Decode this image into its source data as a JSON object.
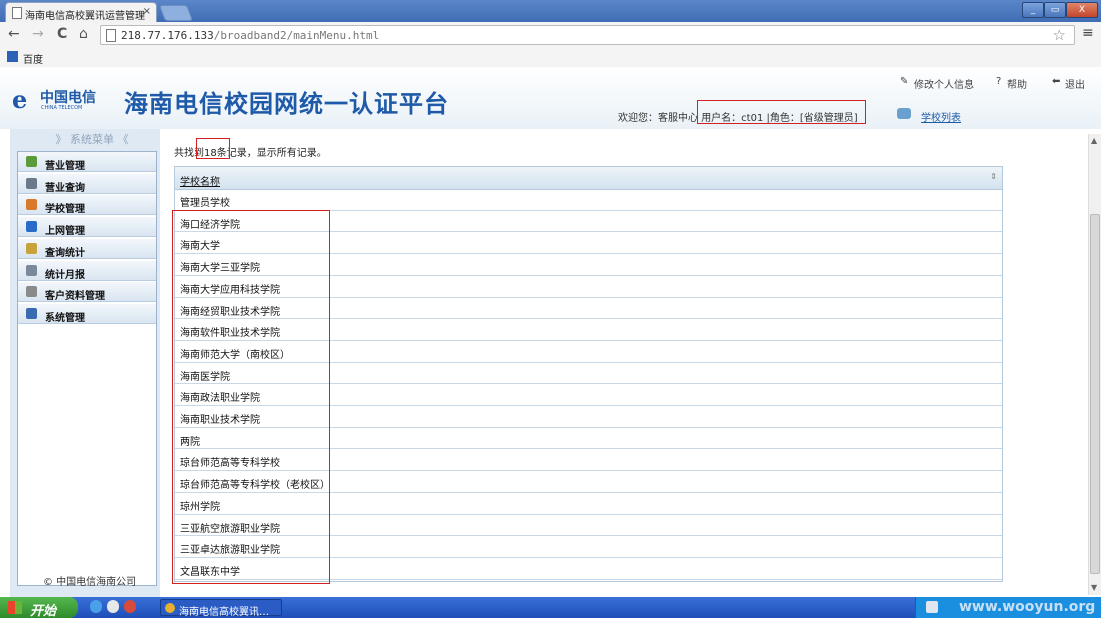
{
  "browser": {
    "tab_title": "海南电信高校翼讯运营管理",
    "tab_close": "×",
    "url_host": "218.77.176.133",
    "url_path": "/broadband2/mainMenu.html",
    "back_glyph": "←",
    "forward_glyph": "→",
    "reload_glyph": "C",
    "home_glyph": "⌂",
    "star_glyph": "☆",
    "menu_glyph": "≡",
    "minimize": "_",
    "restore": "▭",
    "close": "X",
    "bookmark_label": "百度"
  },
  "header": {
    "logo_cn": "中国电信",
    "logo_en": "CHINA TELECOM",
    "logo_e": "e",
    "title": "海南电信校园网统一认证平台",
    "links": {
      "profile": "修改个人信息",
      "help": "帮助",
      "logout": "退出"
    },
    "link_icons": {
      "profile": "wrench-icon",
      "help": "question-icon",
      "logout": "back-arrow-icon"
    },
    "welcome": "欢迎您：客服中心",
    "username": "用户名：ct01",
    "role": "|角色：[省级管理员]",
    "school_list": "学校列表"
  },
  "sidebar": {
    "heading": "》 系统菜单 《",
    "items": [
      {
        "label": "营业管理",
        "icon": "users-icon",
        "color": "#5a9a3a"
      },
      {
        "label": "营业查询",
        "icon": "key-icon",
        "color": "#6a7a8a"
      },
      {
        "label": "学校管理",
        "icon": "school-icon",
        "color": "#d87a2a"
      },
      {
        "label": "上网管理",
        "icon": "monitor-icon",
        "color": "#2a6ac8"
      },
      {
        "label": "查询统计",
        "icon": "report-icon",
        "color": "#c8a23a"
      },
      {
        "label": "统计月报",
        "icon": "table-icon",
        "color": "#7a8a9a"
      },
      {
        "label": "客户资料管理",
        "icon": "edit-icon",
        "color": "#8a8a8a"
      },
      {
        "label": "系统管理",
        "icon": "computer-icon",
        "color": "#3a6ab0"
      }
    ],
    "copyright": "© 中国电信海南公司"
  },
  "content": {
    "found_prefix": "共找到",
    "found_count": "18",
    "found_suffix": "条记录，显示所有记录。",
    "column_header": "学校名称",
    "sort_glyph": "⇕",
    "rows": [
      "管理员学校",
      "海口经济学院",
      "海南大学",
      "海南大学三亚学院",
      "海南大学应用科技学院",
      "海南经贸职业技术学院",
      "海南软件职业技术学院",
      "海南师范大学（南校区）",
      "海南医学院",
      "海南政法职业学院",
      "海南职业技术学院",
      "两院",
      "琼台师范高等专科学校",
      "琼台师范高等专科学校（老校区）",
      "琼州学院",
      "三亚航空旅游职业学院",
      "三亚卓达旅游职业学院",
      "文昌联东中学"
    ]
  },
  "taskbar": {
    "start": "开始",
    "task_label": "海南电信高校翼讯…",
    "watermark": "www.wooyun.org"
  },
  "colors": {
    "brand_blue": "#1e5aa8",
    "highlight_red": "#d42020"
  }
}
